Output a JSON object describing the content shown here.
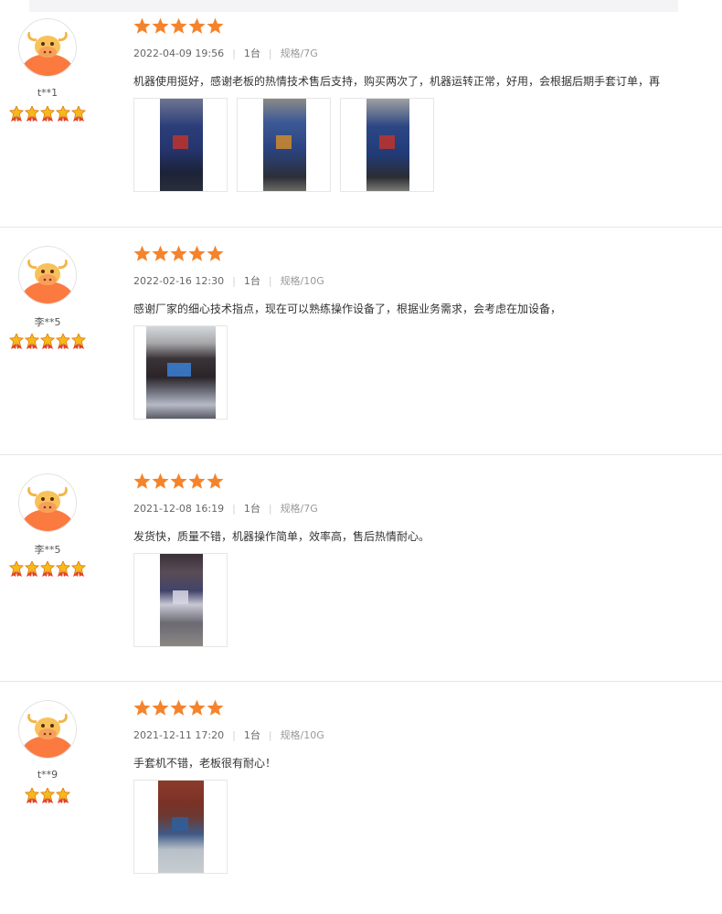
{
  "colors": {
    "star": "#f5832b",
    "avatar_bg": "#fb7a3f",
    "divider": "#e6e6e6",
    "meta_text": "#666666"
  },
  "rating_icon": "star-icon",
  "level_icon": "level-star-icon",
  "reviews": [
    {
      "username": "t**1",
      "rating": 5,
      "level_stars": 5,
      "date": "2022-04-09 19:56",
      "quantity": "1台",
      "spec": "规格/7G",
      "content": "机器使用挺好，感谢老板的热情技术售后支持，购买两次了，机器运转正常，好用，会根据后期手套订单，再",
      "photos": [
        "machine-photo-1",
        "machine-photo-2",
        "machine-photo-3"
      ]
    },
    {
      "username": "李**5",
      "rating": 5,
      "level_stars": 5,
      "date": "2022-02-16 12:30",
      "quantity": "1台",
      "spec": "规格/10G",
      "content": "感谢厂家的细心技术指点，现在可以熟练操作设备了，根据业务需求，会考虑在加设备，",
      "photos": [
        "workshop-photo"
      ]
    },
    {
      "username": "李**5",
      "rating": 5,
      "level_stars": 5,
      "date": "2021-12-08 16:19",
      "quantity": "1台",
      "spec": "规格/7G",
      "content": "发货快，质量不错，机器操作简单，效率高，售后热情耐心。",
      "photos": [
        "factory-photo"
      ]
    },
    {
      "username": "t**9",
      "rating": 5,
      "level_stars": 3,
      "date": "2021-12-11 17:20",
      "quantity": "1台",
      "spec": "规格/10G",
      "content": "手套机不错，老板很有耐心！",
      "photos": [
        "brick-room-photo"
      ]
    }
  ]
}
